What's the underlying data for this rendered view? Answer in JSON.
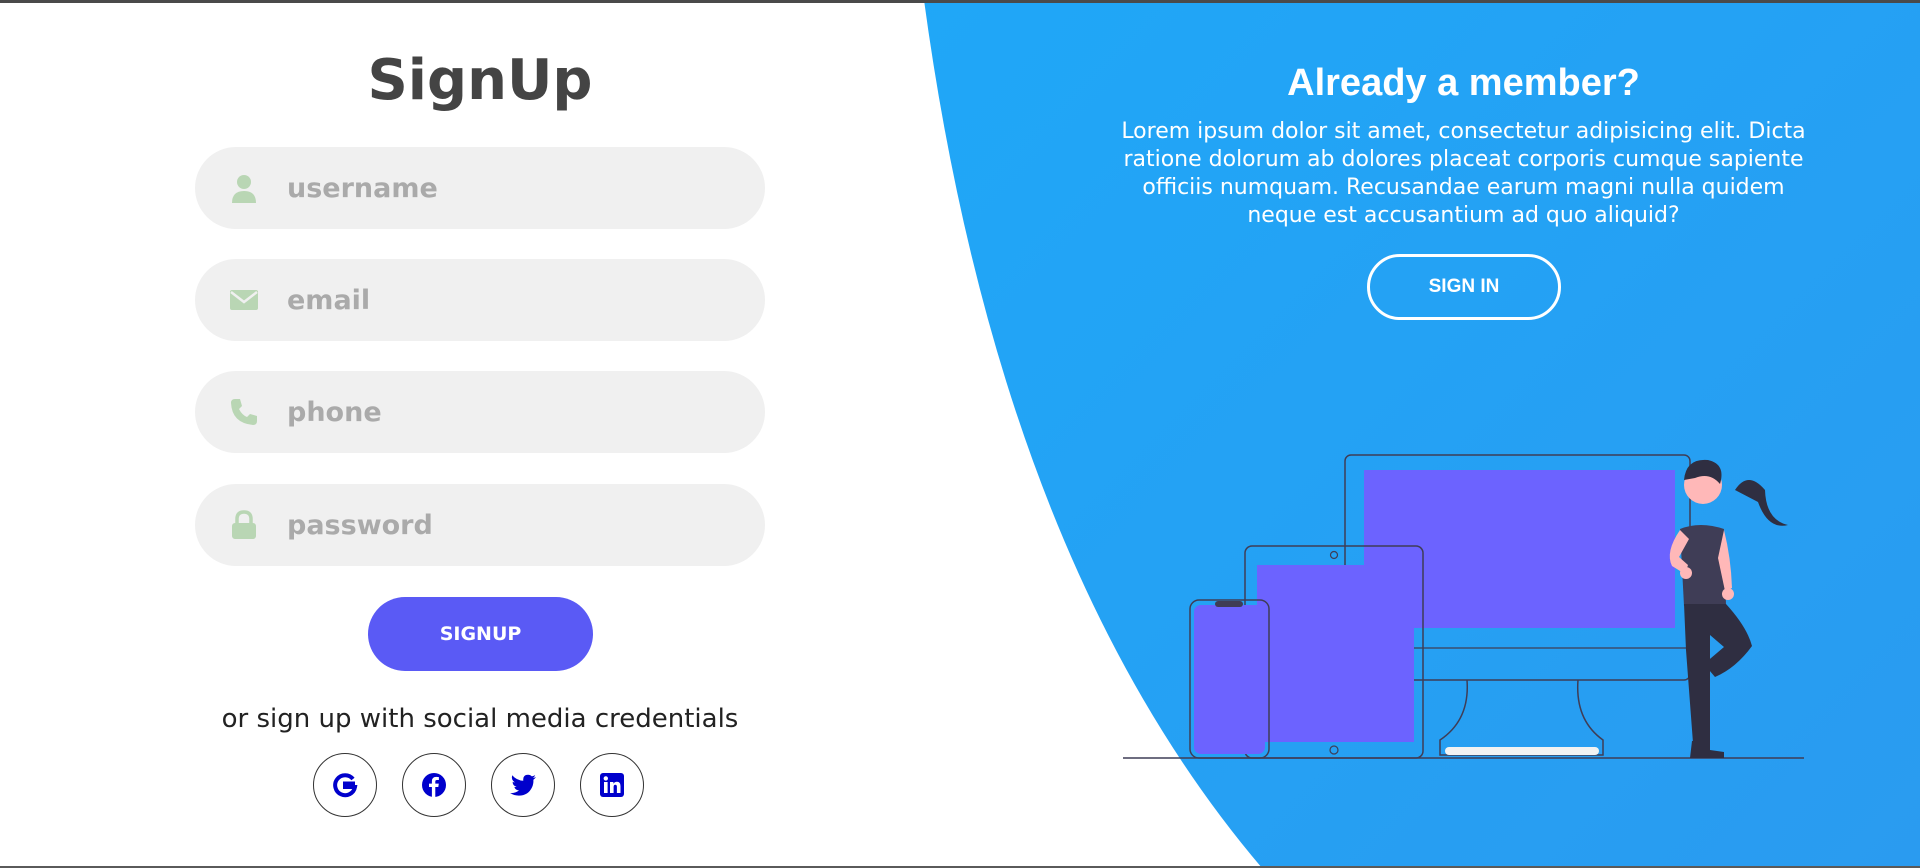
{
  "signup": {
    "title": "SignUp",
    "fields": [
      {
        "icon": "user-icon",
        "placeholder": "username"
      },
      {
        "icon": "envelope-icon",
        "placeholder": "email"
      },
      {
        "icon": "phone-icon",
        "placeholder": "phone"
      },
      {
        "icon": "lock-icon",
        "placeholder": "password"
      }
    ],
    "button_label": "SIGNUP",
    "social_text": "or sign up with social media credentials",
    "social": [
      "google-icon",
      "facebook-icon",
      "twitter-icon",
      "linkedin-icon"
    ]
  },
  "panel": {
    "title": "Already a member?",
    "text": "Lorem ipsum dolor sit amet, consectetur adipisicing elit. Dicta ratione dolorum ab dolores placeat corporis cumque sapiente officiis numquam. Recusandae earum magni nulla quidem neque est accusantium ad quo aliquid?",
    "button_label": "SIGN IN"
  },
  "colors": {
    "accent": "#5a5af5",
    "panel_blue": "#1aadfb",
    "input_bg": "#f0f0f0",
    "icon_green": "#b9d6b4",
    "social_blue": "#0000cc",
    "device_screen": "#6c63ff"
  }
}
